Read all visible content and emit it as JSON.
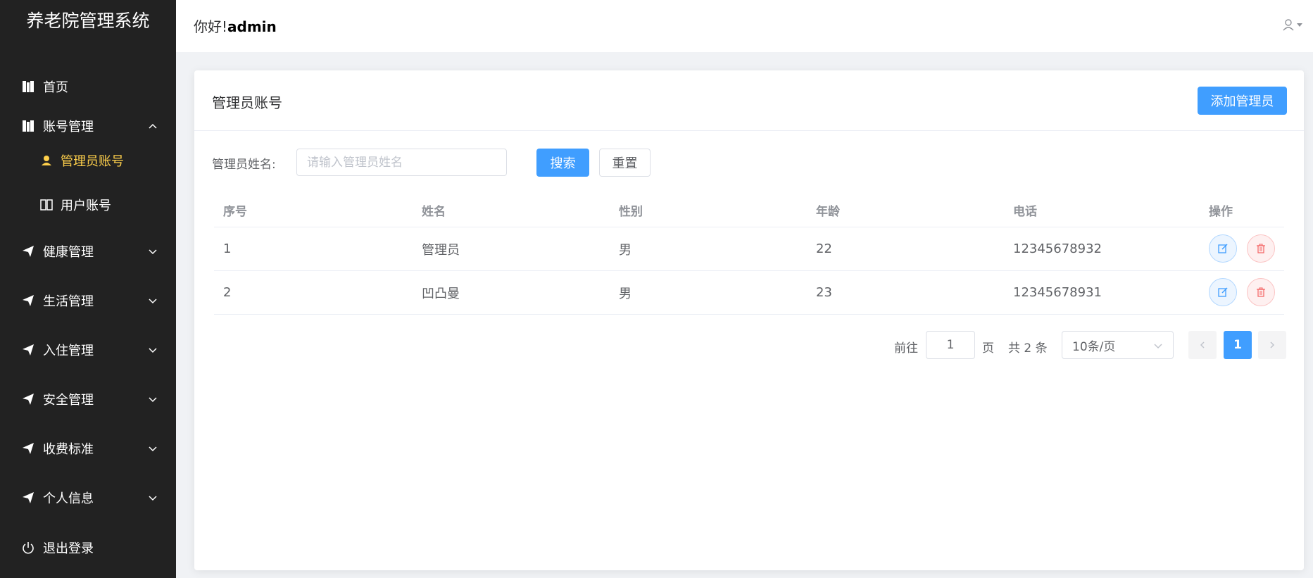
{
  "sidebar": {
    "title": "养老院管理系统",
    "items": [
      {
        "label": "首页",
        "icon": "book-icon"
      },
      {
        "label": "账号管理",
        "icon": "book-icon",
        "expanded": true
      },
      {
        "label": "管理员账号",
        "icon": "user-icon",
        "active": true
      },
      {
        "label": "用户账号",
        "icon": "open-book-icon"
      },
      {
        "label": "健康管理",
        "icon": "paper-plane-icon"
      },
      {
        "label": "生活管理",
        "icon": "paper-plane-icon"
      },
      {
        "label": "入住管理",
        "icon": "paper-plane-icon"
      },
      {
        "label": "安全管理",
        "icon": "paper-plane-icon"
      },
      {
        "label": "收费标准",
        "icon": "paper-plane-icon"
      },
      {
        "label": "个人信息",
        "icon": "paper-plane-icon"
      },
      {
        "label": "退出登录",
        "icon": "power-icon"
      }
    ],
    "active_color": "#ffd04b",
    "background": "#222222"
  },
  "header": {
    "greeting": "你好!",
    "username": "admin"
  },
  "card": {
    "title": "管理员账号",
    "add_button": "添加管理员"
  },
  "search": {
    "label": "管理员姓名:",
    "placeholder": "请输入管理员姓名",
    "search_button": "搜索",
    "reset_button": "重置"
  },
  "table": {
    "columns": [
      "序号",
      "姓名",
      "性别",
      "年龄",
      "电话",
      "操作"
    ],
    "rows": [
      [
        "1",
        "管理员",
        "男",
        "22",
        "12345678932"
      ],
      [
        "2",
        "凹凸曼",
        "男",
        "23",
        "12345678931"
      ]
    ]
  },
  "pagination": {
    "goto_label": "前往",
    "goto_value": "1",
    "page_suffix": "页",
    "total": "共 2 条",
    "page_size": "10条/页",
    "current_page": "1"
  },
  "colors": {
    "primary": "#409eff",
    "danger": "#f56c6c"
  }
}
